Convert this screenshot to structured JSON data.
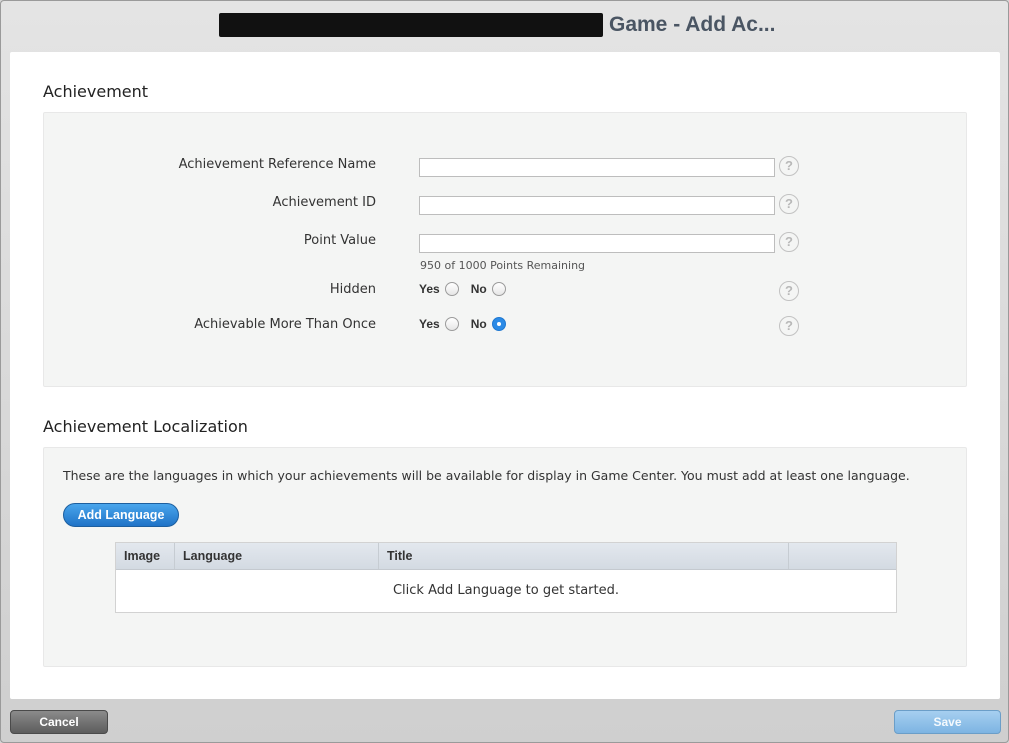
{
  "window": {
    "title_visible": "Game - Add Ac..."
  },
  "achievement": {
    "section_title": "Achievement",
    "fields": {
      "reference_name_label": "Achievement Reference Name",
      "reference_name_value": "",
      "id_label": "Achievement ID",
      "id_value": "",
      "point_value_label": "Point Value",
      "point_value_value": "",
      "points_remaining": "950 of 1000 Points Remaining",
      "hidden_label": "Hidden",
      "hidden_selected": "none",
      "achievable_label": "Achievable More Than Once",
      "achievable_selected": "No",
      "yes_label": "Yes",
      "no_label": "No",
      "help_glyph": "?"
    }
  },
  "localization": {
    "section_title": "Achievement Localization",
    "description": "These are the languages in which your achievements will be available for display in Game Center. You must add at least one language.",
    "add_language_label": "Add Language",
    "table": {
      "columns": [
        "Image",
        "Language",
        "Title",
        ""
      ],
      "empty_message": "Click Add Language to get started."
    }
  },
  "footer": {
    "cancel_label": "Cancel",
    "save_label": "Save"
  },
  "colors": {
    "accent_blue": "#2b8ae6",
    "title_text": "#4a5563"
  },
  "icons": {
    "help": "question-circle-icon",
    "redaction": "redaction-bar"
  }
}
